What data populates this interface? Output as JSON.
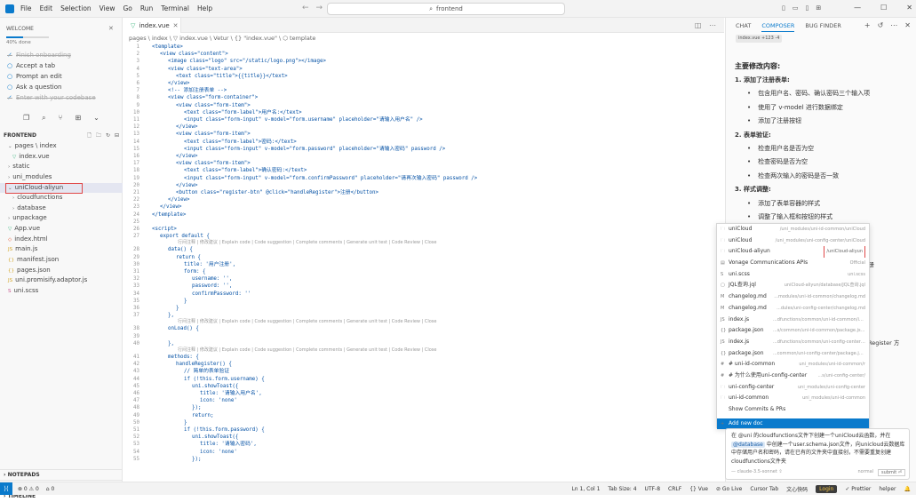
{
  "menu": [
    "File",
    "Edit",
    "Selection",
    "View",
    "Go",
    "Run",
    "Terminal",
    "Help"
  ],
  "search": {
    "text": "frontend"
  },
  "welcome": {
    "title": "WELCOME",
    "progress": 0.4,
    "progress_text": "40% done",
    "steps": [
      {
        "label": "Finish onboarding",
        "done": true
      },
      {
        "label": "Accept a tab",
        "done": false
      },
      {
        "label": "Prompt an edit",
        "done": false
      },
      {
        "label": "Ask a question",
        "done": false
      },
      {
        "label": "Enter with your codebase",
        "done": true
      }
    ]
  },
  "explorer": {
    "root": "FRONTEND",
    "items": [
      {
        "label": "pages \\ index",
        "indent": 1,
        "type": "folder-open"
      },
      {
        "label": "index.vue",
        "indent": 2,
        "type": "vue"
      },
      {
        "label": "static",
        "indent": 1,
        "type": "folder"
      },
      {
        "label": "uni_modules",
        "indent": 1,
        "type": "folder"
      },
      {
        "label": "uniCloud-aliyun",
        "indent": 1,
        "type": "folder-open",
        "selected": true
      },
      {
        "label": "cloudfunctions",
        "indent": 2,
        "type": "folder"
      },
      {
        "label": "database",
        "indent": 2,
        "type": "folder"
      },
      {
        "label": "unpackage",
        "indent": 1,
        "type": "folder"
      },
      {
        "label": "App.vue",
        "indent": 1,
        "type": "vue"
      },
      {
        "label": "index.html",
        "indent": 1,
        "type": "html"
      },
      {
        "label": "main.js",
        "indent": 1,
        "type": "js"
      },
      {
        "label": "manifest.json",
        "indent": 1,
        "type": "json"
      },
      {
        "label": "pages.json",
        "indent": 1,
        "type": "json"
      },
      {
        "label": "uni.promisify.adaptor.js",
        "indent": 1,
        "type": "js"
      },
      {
        "label": "uni.scss",
        "indent": 1,
        "type": "scss"
      }
    ],
    "bottom": [
      "NOTEPADS",
      "OUTLINE",
      "TIMELINE"
    ]
  },
  "tab": {
    "label": "index.vue"
  },
  "breadcrumb": "pages \\ index \\ ▽ index.vue \\ Vetur \\ {} \"index.vue\" \\ ⬡ template",
  "code": [
    {
      "n": "1",
      "t": "<template>",
      "i": 0
    },
    {
      "n": "2",
      "t": "<view class=\"content\">",
      "i": 1
    },
    {
      "n": "3",
      "t": "<image class=\"logo\" src=\"/static/logo.png\"></image>",
      "i": 2
    },
    {
      "n": "4",
      "t": "<view class=\"text-area\">",
      "i": 2
    },
    {
      "n": "5",
      "t": "<text class=\"title\">{{title}}</text>",
      "i": 3
    },
    {
      "n": "6",
      "t": "</view>",
      "i": 2
    },
    {
      "n": "7",
      "t": "<!-- 添加注册表单 -->",
      "i": 2
    },
    {
      "n": "8",
      "t": "<view class=\"form-container\">",
      "i": 2
    },
    {
      "n": "9",
      "t": "<view class=\"form-item\">",
      "i": 3
    },
    {
      "n": "10",
      "t": "<text class=\"form-label\">用户名:</text>",
      "i": 4
    },
    {
      "n": "11",
      "t": "<input class=\"form-input\" v-model=\"form.username\" placeholder=\"请输入用户名\" />",
      "i": 4
    },
    {
      "n": "12",
      "t": "</view>",
      "i": 3
    },
    {
      "n": "13",
      "t": "<view class=\"form-item\">",
      "i": 3
    },
    {
      "n": "14",
      "t": "<text class=\"form-label\">密码:</text>",
      "i": 4
    },
    {
      "n": "15",
      "t": "<input class=\"form-input\" v-model=\"form.password\" placeholder=\"请输入密码\" password />",
      "i": 4
    },
    {
      "n": "16",
      "t": "</view>",
      "i": 3
    },
    {
      "n": "17",
      "t": "<view class=\"form-item\">",
      "i": 3
    },
    {
      "n": "18",
      "t": "<text class=\"form-label\">确认密码:</text>",
      "i": 4
    },
    {
      "n": "19",
      "t": "<input class=\"form-input\" v-model=\"form.confirmPassword\" placeholder=\"请再次输入密码\" password />",
      "i": 4
    },
    {
      "n": "20",
      "t": "</view>",
      "i": 3
    },
    {
      "n": "21",
      "t": "<button class=\"register-btn\" @click=\"handleRegister\">注册</button>",
      "i": 3
    },
    {
      "n": "22",
      "t": "</view>",
      "i": 2
    },
    {
      "n": "23",
      "t": "</view>",
      "i": 1
    },
    {
      "n": "24",
      "t": "</template>",
      "i": 0
    },
    {
      "n": "25",
      "t": "",
      "i": 0
    },
    {
      "n": "26",
      "t": "<script>",
      "i": 0
    },
    {
      "n": "27",
      "t": "export default {",
      "i": 1
    },
    {
      "n": "28",
      "t": "data() {",
      "i": 2
    },
    {
      "n": "29",
      "t": "return {",
      "i": 3
    },
    {
      "n": "30",
      "t": "title: '用户注册',",
      "i": 4
    },
    {
      "n": "31",
      "t": "form: {",
      "i": 4
    },
    {
      "n": "32",
      "t": "username: '',",
      "i": 5
    },
    {
      "n": "33",
      "t": "password: '',",
      "i": 5
    },
    {
      "n": "34",
      "t": "confirmPassword: ''",
      "i": 5
    },
    {
      "n": "35",
      "t": "}",
      "i": 4
    },
    {
      "n": "36",
      "t": "}",
      "i": 3
    },
    {
      "n": "37",
      "t": "},",
      "i": 2
    },
    {
      "n": "38",
      "t": "onLoad() {",
      "i": 2
    },
    {
      "n": "39",
      "t": "",
      "i": 0
    },
    {
      "n": "40",
      "t": "},",
      "i": 2
    },
    {
      "n": "41",
      "t": "methods: {",
      "i": 2
    },
    {
      "n": "42",
      "t": "handleRegister() {",
      "i": 3
    },
    {
      "n": "43",
      "t": "// 简单的表单验证",
      "i": 4
    },
    {
      "n": "44",
      "t": "if (!this.form.username) {",
      "i": 4
    },
    {
      "n": "45",
      "t": "uni.showToast({",
      "i": 5
    },
    {
      "n": "46",
      "t": "title: '请输入用户名',",
      "i": 6
    },
    {
      "n": "47",
      "t": "icon: 'none'",
      "i": 6
    },
    {
      "n": "48",
      "t": "});",
      "i": 5
    },
    {
      "n": "49",
      "t": "return;",
      "i": 5
    },
    {
      "n": "50",
      "t": "}",
      "i": 4
    },
    {
      "n": "51",
      "t": "if (!this.form.password) {",
      "i": 4
    },
    {
      "n": "52",
      "t": "uni.showToast({",
      "i": 5
    },
    {
      "n": "53",
      "t": "title: '请输入密码',",
      "i": 6
    },
    {
      "n": "54",
      "t": "icon: 'none'",
      "i": 6
    },
    {
      "n": "55",
      "t": "});",
      "i": 5
    }
  ],
  "codelens": "行间注释 | 修改建议 | Explain code | Code suggestion | Complete comments | Generate unit test | Code Review | Close",
  "codelens_after": [
    "27",
    "37",
    "40"
  ],
  "right": {
    "tabs": [
      "CHAT",
      "COMPOSER",
      "BUG FINDER"
    ],
    "active_tab": "COMPOSER",
    "file_ref": "index.vue +123 -4",
    "summary_title": "主要修改内容:",
    "items": [
      {
        "text": "1. 添加了注册表单:",
        "kind": "n"
      },
      {
        "text": "包含用户名、密码、确认密码三个输入项",
        "kind": "b"
      },
      {
        "text": "使用了 v-model 进行数据绑定",
        "kind": "b"
      },
      {
        "text": "添加了注册按钮",
        "kind": "b"
      },
      {
        "text": "2. 表单验证:",
        "kind": "n"
      },
      {
        "text": "检查用户名是否为空",
        "kind": "b"
      },
      {
        "text": "检查密码是否为空",
        "kind": "b"
      },
      {
        "text": "检查两次输入的密码是否一致",
        "kind": "b"
      },
      {
        "text": "3. 样式调整:",
        "kind": "n"
      },
      {
        "text": "添加了表单容器的样式",
        "kind": "b"
      },
      {
        "text": "调整了输入框和按钮的样式",
        "kind": "b"
      }
    ],
    "side_text_1": "注册",
    "side_text_2": "Register 方"
  },
  "mention": {
    "items": [
      {
        "name": "uniCloud",
        "path": "/uni_modules/uni-id-common/uniCloud",
        "icon": "folder"
      },
      {
        "name": "uniCloud",
        "path": "/uni_modules/uni-config-center/uniCloud",
        "icon": "folder"
      },
      {
        "name": "uniCloud-aliyun",
        "path": "/uniCloud-aliyun",
        "icon": "folder",
        "highlight": true
      },
      {
        "name": "Vonage Communications APIs",
        "path": "Official",
        "icon": "doc"
      },
      {
        "name": "uni.scss",
        "path": "uni.scss",
        "icon": "scss"
      },
      {
        "name": "JQL查询.jql",
        "path": "uniCloud-aliyun/database/JQL查询.jql",
        "icon": "file"
      },
      {
        "name": "changelog.md",
        "path": "...modules/uni-id-common/changelog.md",
        "icon": "md"
      },
      {
        "name": "changelog.md",
        "path": "...dules/uni-config-center/changelog.md",
        "icon": "md"
      },
      {
        "name": "index.js",
        "path": "...dfunctions/common/uni-id-common/index.js",
        "icon": "js"
      },
      {
        "name": "package.json",
        "path": "...s/common/uni-id-common/package.json",
        "icon": "json"
      },
      {
        "name": "index.js",
        "path": "...dfunctions/common/uni-config-center/index.js",
        "icon": "js"
      },
      {
        "name": "package.json",
        "path": "...common/uni-config-center/package.json",
        "icon": "json"
      },
      {
        "name": "# uni-id-common",
        "path": "uni_modules/uni-id-common/r",
        "icon": "hash"
      },
      {
        "name": "# 为什么使用uni-config-center",
        "path": "...s/uni-config-center/",
        "icon": "hash"
      },
      {
        "name": "uni-config-center",
        "path": "uni_modules/uni-config-center",
        "icon": "folder"
      },
      {
        "name": "uni-id-common",
        "path": "uni_modules/uni-id-common",
        "icon": "folder"
      },
      {
        "name": "Show Commits & PRs",
        "path": "",
        "icon": ""
      }
    ],
    "add_new": "Add new doc"
  },
  "composer_box": {
    "before": "在 @uni 的cloudfunctions文件下创建一个uniCloud云函数，并在",
    "chip": "@database",
    "after": "中创建一个user.schema.json文件，向unicloud云数据库中存储用户名和密码，请在已有的文件夹中直接创，不需要重复创建cloudfunctions文件夹",
    "footer_left": "— claude-3.5-sonnet ⇧",
    "footer_mode": "normal",
    "submit": "submit ⏎"
  },
  "status": {
    "errors": "⊗ 0 ⚠ 0",
    "ports": "⌂ 0",
    "right": [
      "Ln 1, Col 1",
      "Tab Size: 4",
      "UTF-8",
      "CRLF",
      "{} Vue",
      "⊘ Go Live",
      "Cursor Tab",
      "文心快码",
      "Login",
      "✓ Prettier",
      "helper",
      "🔔"
    ]
  }
}
